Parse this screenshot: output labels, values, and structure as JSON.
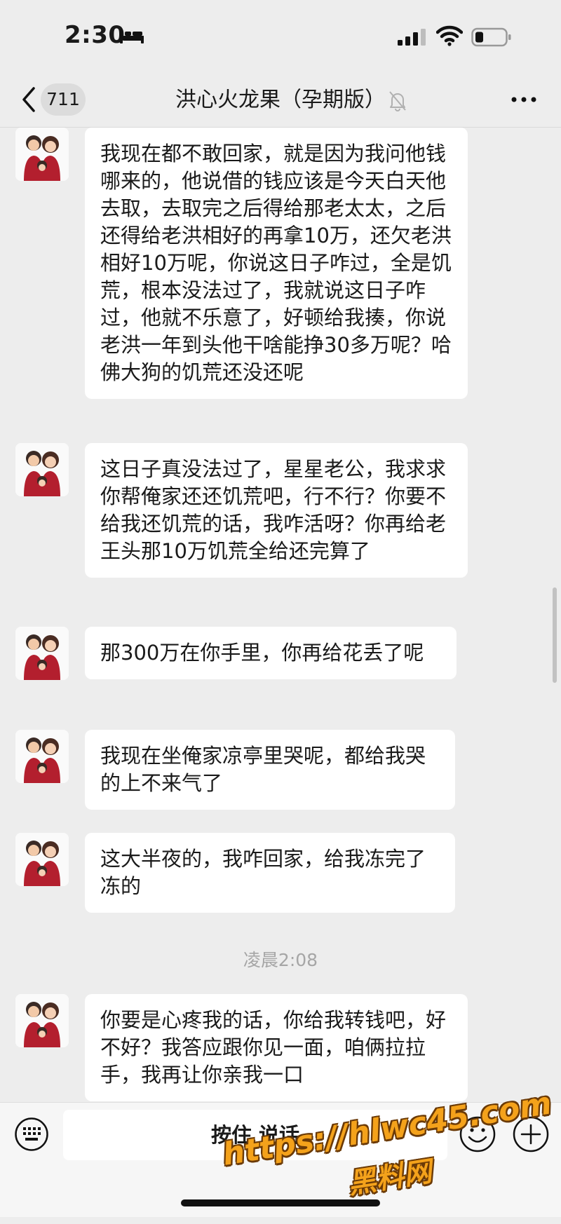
{
  "status_bar": {
    "time": "2:30",
    "icons": [
      "sleep-bed-icon",
      "cellular-signal-icon",
      "wifi-icon",
      "battery-icon"
    ]
  },
  "nav": {
    "back_icon": "chevron-left-icon",
    "unread_count": "711",
    "title": "洪心火龙果（孕期版）",
    "mute_icon": "bell-slash-icon",
    "more_icon": "more-dots-icon"
  },
  "messages": [
    {
      "type": "text",
      "text": "我现在都不敢回家，就是因为我问他钱哪来的，他说借的钱应该是今天白天他去取，去取完之后得给那老太太，之后还得给老洪相好的再拿10万，还欠老洪相好10万呢，你说这日子咋过，全是饥荒，根本没法过了，我就说这日子咋过，他就不乐意了，好顿给我揍，你说老洪一年到头他干啥能挣30多万呢？哈佛大狗的饥荒还没还呢"
    },
    {
      "type": "text",
      "text": "这日子真没法过了，星星老公，我求求你帮俺家还还饥荒吧，行不行？你要不给我还饥荒的话，我咋活呀？你再给老王头那10万饥荒全给还完算了"
    },
    {
      "type": "text",
      "text": "那300万在你手里，你再给花丢了呢"
    },
    {
      "type": "text",
      "text": "我现在坐俺家凉亭里哭呢，都给我哭的上不来气了"
    },
    {
      "type": "text",
      "text": "这大半夜的，我咋回家，给我冻完了冻的"
    },
    {
      "type": "time",
      "text": "凌晨2:08"
    },
    {
      "type": "text",
      "text": "你要是心疼我的话，你给我转钱吧，好不好？我答应跟你见一面，咱俩拉拉手，我再让你亲我一口"
    }
  ],
  "input_bar": {
    "keyboard_icon": "keyboard-icon",
    "voice_label": "按住 说话",
    "emoji_icon": "emoji-icon",
    "plus_icon": "plus-circle-icon"
  },
  "watermark": {
    "url": "https://hlwc45.com",
    "site": "黑料网"
  }
}
